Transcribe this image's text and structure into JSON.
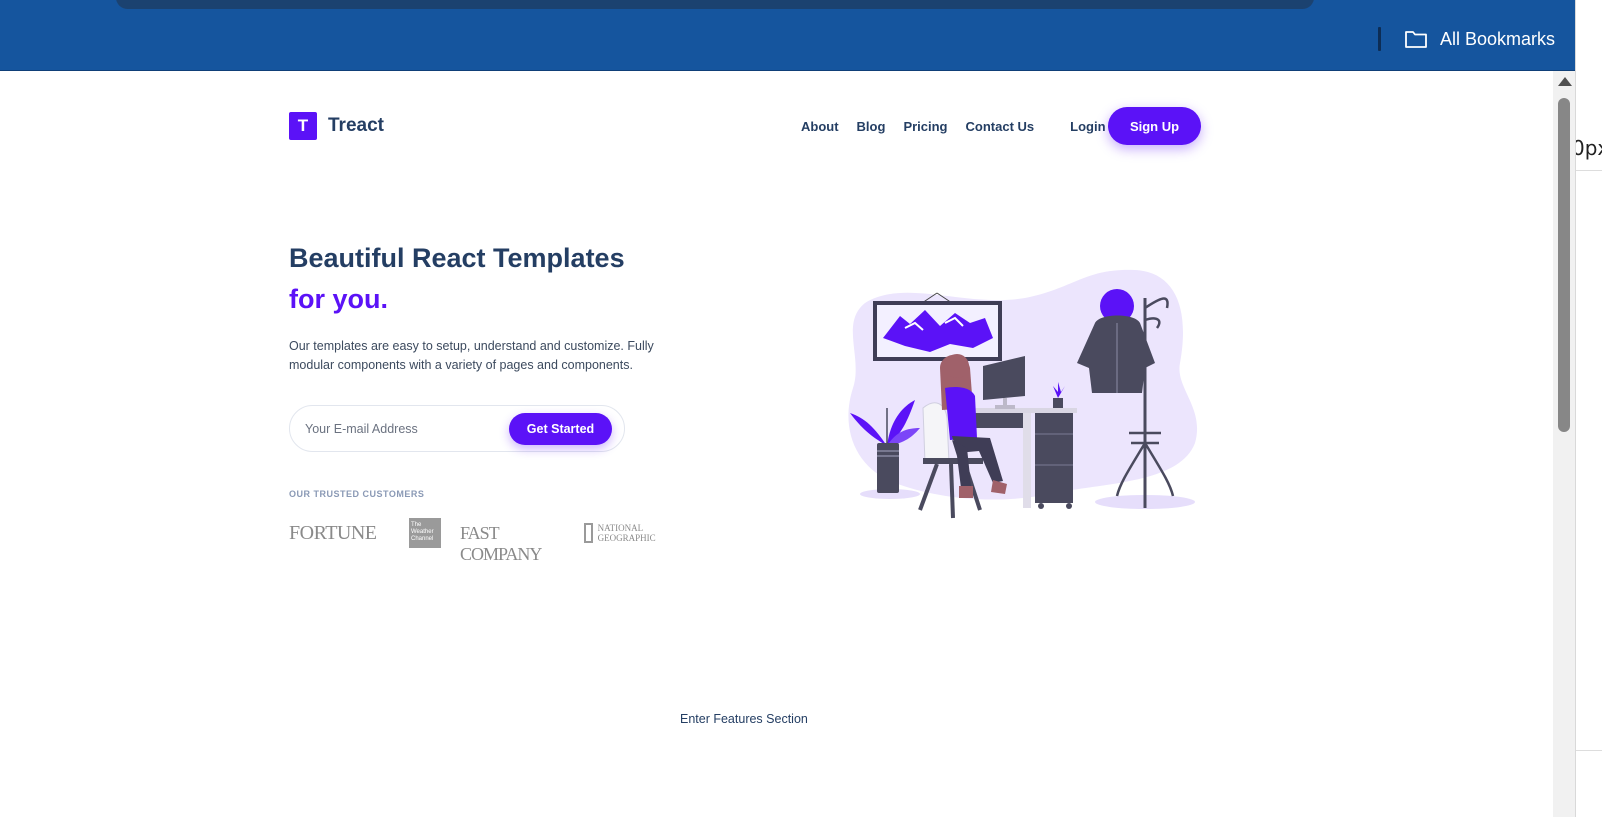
{
  "browser": {
    "bookmarks_label": "All Bookmarks",
    "folder_icon": "folder-icon",
    "bar_color": "#15559e"
  },
  "side_panel": {
    "fragment_text": "0px"
  },
  "site": {
    "brand": {
      "logo_letter": "T",
      "name": "Treact"
    },
    "nav": {
      "links": [
        "About",
        "Blog",
        "Pricing",
        "Contact Us"
      ],
      "login": "Login",
      "signup": "Sign Up"
    },
    "hero": {
      "title_line1": "Beautiful React Templates",
      "title_line2": "for you.",
      "description": "Our templates are easy to setup, understand and customize. Fully modular components with a variety of pages and components.",
      "email_placeholder": "Your E-mail Address",
      "cta": "Get Started"
    },
    "trusted": {
      "label": "OUR TRUSTED CUSTOMERS",
      "logos": [
        "FORTUNE",
        "The Weather Channel",
        "FASTCOMPANY",
        "NATIONAL GEOGRAPHIC"
      ],
      "fortune": "FORTUNE",
      "weather": "The Weather Channel",
      "fastco": "FAST COMPANY",
      "natgeo": "NATIONAL GEOGRAPHIC"
    },
    "features_placeholder": "Enter Features Section",
    "colors": {
      "primary": "#5b12f7",
      "heading": "#243e63",
      "muted": "#8a99b5"
    }
  }
}
